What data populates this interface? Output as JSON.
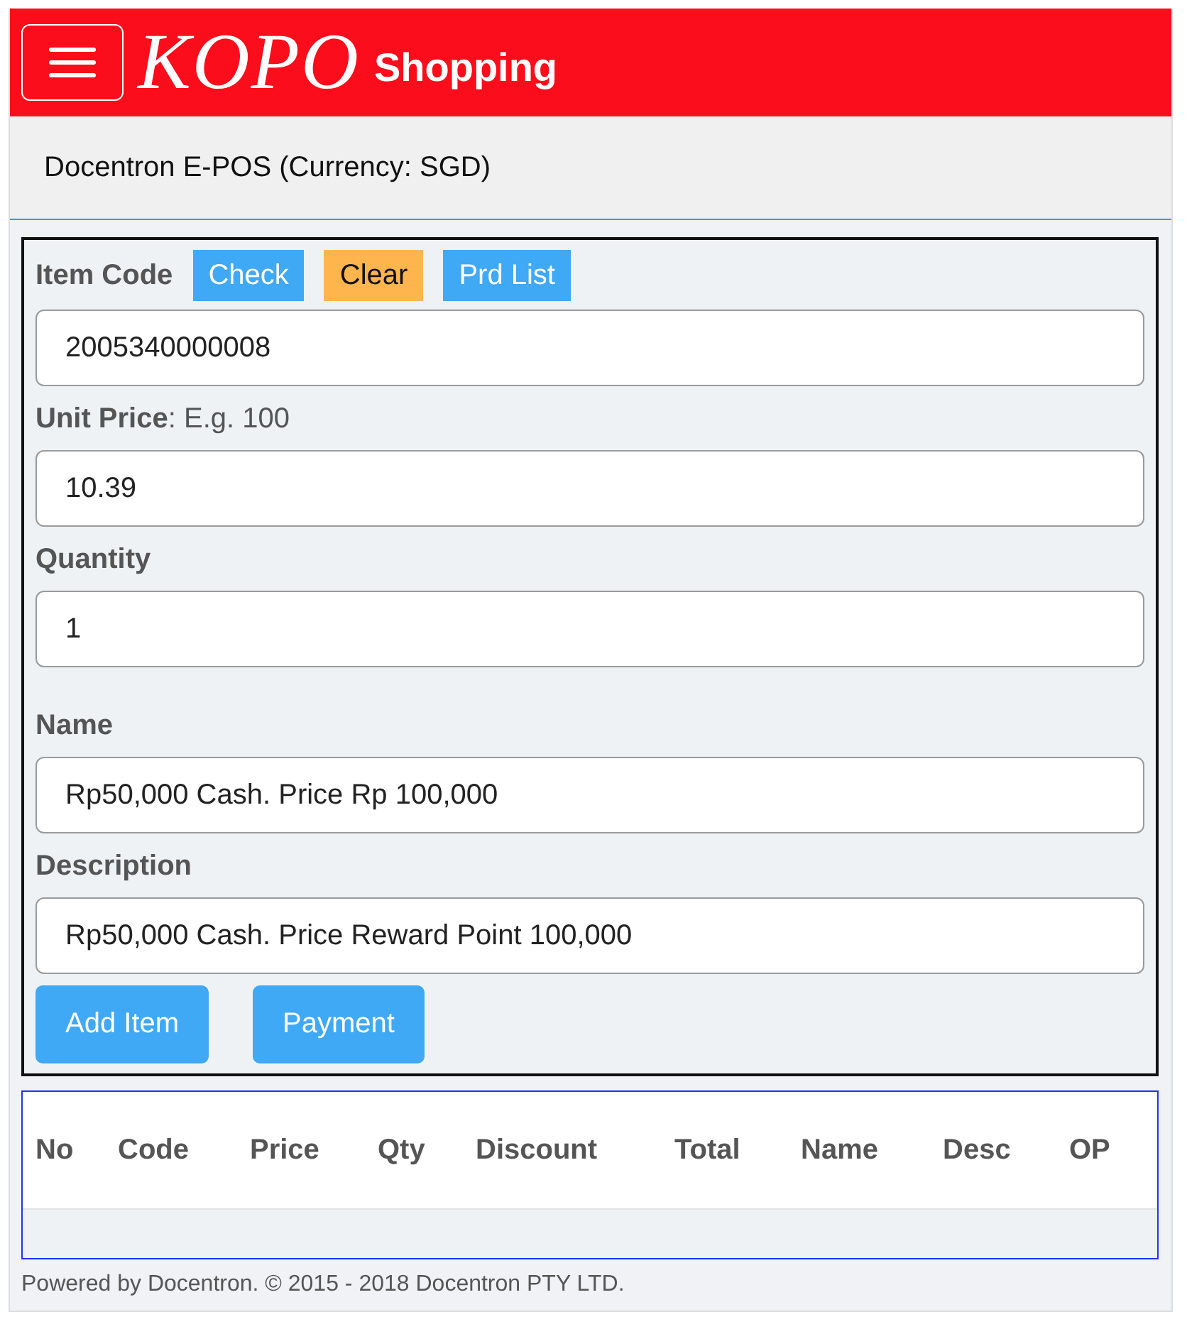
{
  "header": {
    "brand": "KOPO",
    "subtitle": "Shopping"
  },
  "subheader": {
    "title": "Docentron E-POS (Currency: SGD)"
  },
  "form": {
    "item_code": {
      "label": "Item Code",
      "buttons": [
        {
          "label": "Check",
          "kind": "primary"
        },
        {
          "label": "Clear",
          "kind": "warning"
        },
        {
          "label": "Prd List",
          "kind": "primary"
        }
      ]
    },
    "fields": [
      {
        "value": "2005340000008"
      },
      {
        "label": "Unit Price",
        "hint": ": E.g. 100",
        "value": "10.39"
      },
      {
        "label": "Quantity",
        "value": "1"
      },
      {
        "label": "Name",
        "value": "Rp50,000 Cash. Price Rp 100,000"
      },
      {
        "label": "Description",
        "value": "Rp50,000 Cash. Price Reward Point 100,000"
      }
    ],
    "actions": [
      "Add Item",
      "Payment"
    ]
  },
  "table": {
    "columns": [
      "No",
      "Code",
      "Price",
      "Qty",
      "Discount",
      "Total",
      "Name",
      "Desc",
      "OP"
    ]
  },
  "footer": "Powered by Docentron. © 2015 - 2018 Docentron PTY LTD."
}
